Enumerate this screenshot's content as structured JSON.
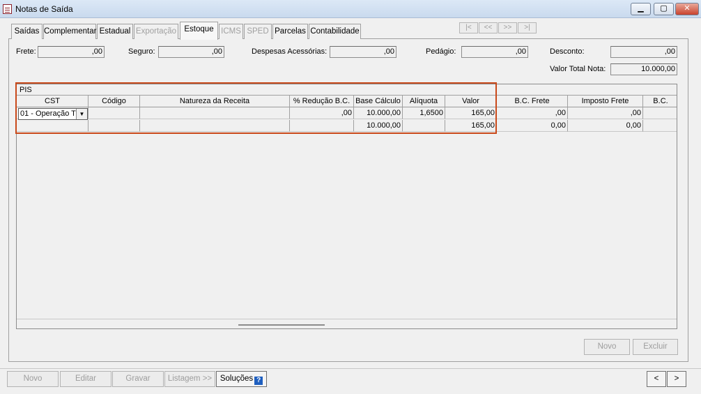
{
  "window": {
    "title": "Notas de Saída"
  },
  "tabs": [
    {
      "label": "Saídas",
      "state": "normal"
    },
    {
      "label": "Complementar",
      "state": "normal"
    },
    {
      "label": "Estadual",
      "state": "normal"
    },
    {
      "label": "Exportação",
      "state": "disabled"
    },
    {
      "label": "Estoque",
      "state": "active"
    },
    {
      "label": "ICMS",
      "state": "disabled"
    },
    {
      "label": "SPED",
      "state": "disabled"
    },
    {
      "label": "Parcelas",
      "state": "normal"
    },
    {
      "label": "Contabilidade",
      "state": "normal"
    }
  ],
  "record_nav": {
    "first": "|<",
    "prev": "<<",
    "next": ">>",
    "last": ">|"
  },
  "fields": {
    "frete_label": "Frete:",
    "frete_value": ",00",
    "seguro_label": "Seguro:",
    "seguro_value": ",00",
    "despesas_label": "Despesas Acessórias:",
    "despesas_value": ",00",
    "pedagio_label": "Pedágio:",
    "pedagio_value": ",00",
    "desconto_label": "Desconto:",
    "desconto_value": ",00",
    "valor_total_label": "Valor Total Nota:",
    "valor_total_value": "10.000,00"
  },
  "grid": {
    "title": "PIS",
    "columns": [
      "CST",
      "Código",
      "Natureza da Receita",
      "% Redução B.C.",
      "Base Cálculo",
      "Alíquota",
      "Valor",
      "B.C. Frete",
      "Imposto Frete",
      "B.C."
    ],
    "row1": {
      "cst": "01 - Operação T",
      "codigo": "",
      "natureza": "",
      "reducao": ",00",
      "base": "10.000,00",
      "aliquota": "1,6500",
      "valor": "165,00",
      "bc_frete": ",00",
      "imposto_frete": ",00"
    },
    "totals": {
      "base": "10.000,00",
      "valor": "165,00",
      "bc_frete": "0,00",
      "imposto_frete": "0,00"
    }
  },
  "panel_buttons": {
    "novo": "Novo",
    "excluir": "Excluir"
  },
  "footer_buttons": {
    "novo": "Novo",
    "editar": "Editar",
    "gravar": "Gravar",
    "listagem": "Listagem >>",
    "solucoes": "Soluções",
    "prev": "<",
    "next": ">"
  },
  "icons": {
    "dropdown": "chevron-down-icon",
    "help": "help-icon"
  },
  "colors": {
    "highlight": "#c9491a",
    "help": "#1f5fbf"
  }
}
